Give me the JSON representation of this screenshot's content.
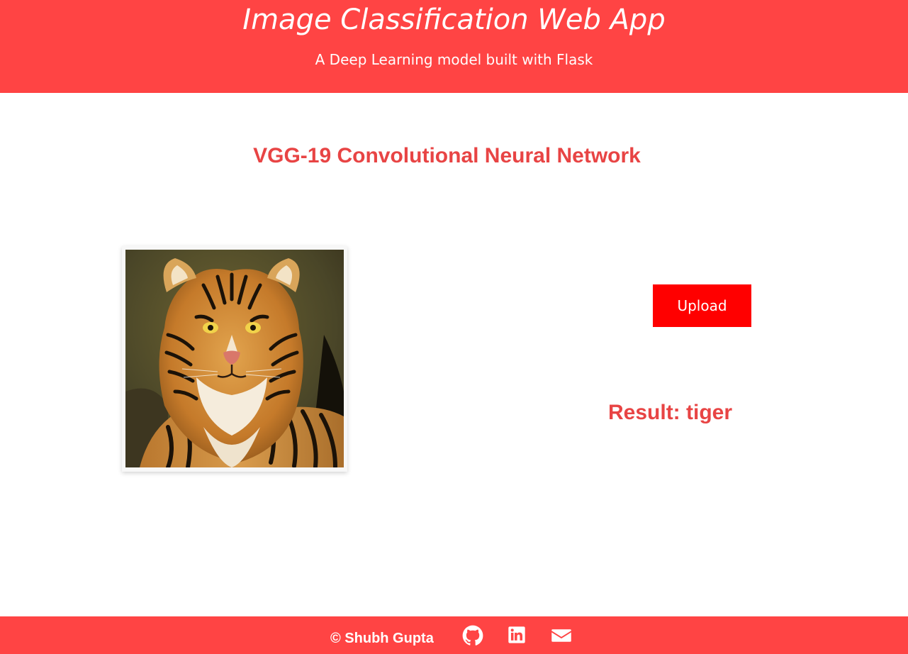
{
  "header": {
    "title": "Image Classification Web App",
    "subtitle": "A Deep Learning model built with Flask"
  },
  "main": {
    "model_heading": "VGG-19 Convolutional Neural Network",
    "upload_label": "Upload",
    "result_text": "Result: tiger"
  },
  "image": {
    "description": "tiger"
  },
  "footer": {
    "copyright": "© Shubh Gupta",
    "icons": [
      "github-icon",
      "linkedin-icon",
      "email-icon"
    ]
  },
  "colors": {
    "brand": "#ff4444",
    "accent_text": "#e84444",
    "button": "#ff0000",
    "on_brand": "#ffffff"
  }
}
